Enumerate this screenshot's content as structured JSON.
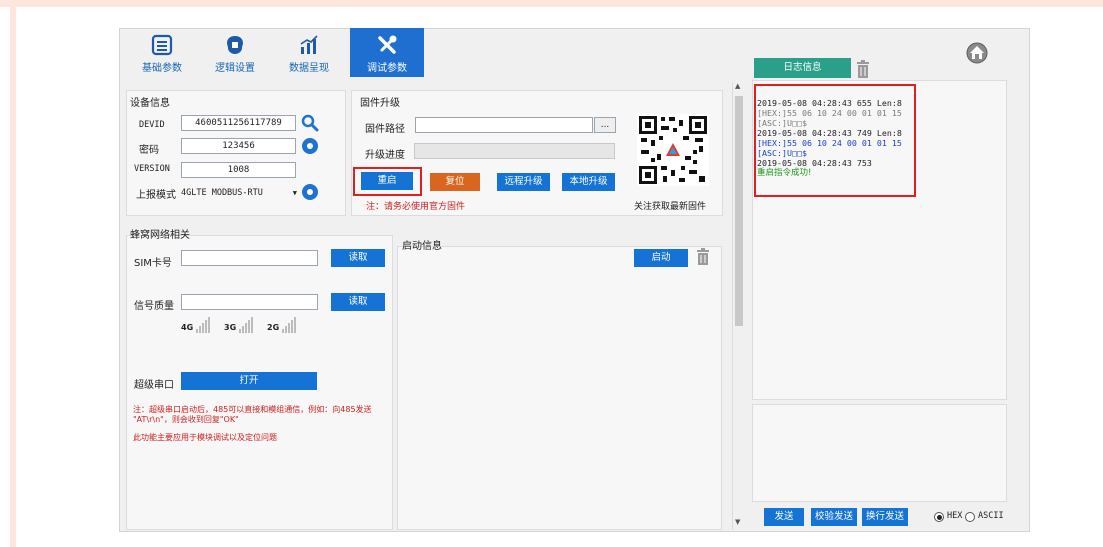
{
  "tabs": [
    {
      "label": "基础参数",
      "icon": "list-icon"
    },
    {
      "label": "逻辑设置",
      "icon": "brain-chip-icon"
    },
    {
      "label": "数据呈现",
      "icon": "chart-icon"
    },
    {
      "label": "调试参数",
      "icon": "wrench-icon",
      "active": true
    }
  ],
  "device": {
    "section_title": "设备信息",
    "devid_label": "DEVID",
    "devid_value": "4600511256117789",
    "password_label": "密码",
    "password_value": "123456",
    "version_label": "VERSION",
    "version_value": "1008",
    "report_mode_label": "上报模式",
    "report_mode_value": "4GLTE  MODBUS-RTU"
  },
  "firmware": {
    "section_title": "固件升级",
    "path_label": "固件路径",
    "browse_label": "...",
    "progress_label": "升级进度",
    "restart_label": "重启",
    "reset_label": "复位",
    "remote_upgrade_label": "远程升级",
    "local_upgrade_label": "本地升级",
    "note": "注：请务必使用官方固件",
    "qr_caption": "关注获取最新固件"
  },
  "cellular": {
    "section_title": "蜂窝网络相关",
    "sim_label": "SIM卡号",
    "sim_read_label": "读取",
    "signal_label": "信号质量",
    "signal_read_label": "读取",
    "signal_4g": "4G",
    "signal_3g": "3G",
    "signal_2g": "2G",
    "serial_label": "超级串口",
    "serial_open_label": "打开",
    "note1": "注：超级串口启动后，485可以直接和模组通信，例如：向485发送",
    "note2": "\"AT\\r\\n\"，则会收到回复\"OK\"",
    "note3": "此功能主要应用于模块调试以及定位问题"
  },
  "boot": {
    "section_title": "启动信息",
    "start_label": "启动"
  },
  "log": {
    "tab_label": "日志信息",
    "lines": [
      {
        "text": "2019-05-08 04:28:43 655 Len:8",
        "color": "#222222"
      },
      {
        "text": "[HEX:]55 06 10 24 00 01 01 15",
        "color": "#7a7a7a"
      },
      {
        "text": "[ASC:]U□□$",
        "color": "#7a7a7a"
      },
      {
        "text": "2019-05-08 04:28:43 749 Len:8",
        "color": "#222222"
      },
      {
        "text": "[HEX:]55 06 10 24 00 01 01 15",
        "color": "#1a3fd1"
      },
      {
        "text": "[ASC:]U□□$",
        "color": "#1a3fd1"
      },
      {
        "text": "2019-05-08 04:28:43 753",
        "color": "#222222"
      },
      {
        "text": "重启指令成功!",
        "color": "#1a9a1a"
      }
    ],
    "send_label": "发送",
    "checksum_send_label": "校验发送",
    "newline_send_label": "换行发送",
    "hex_label": "HEX",
    "ascii_label": "ASCII",
    "format_selected": "HEX"
  },
  "colors": {
    "accent_blue": "#1e6fd0",
    "button_blue": "#1473d4",
    "button_orange": "#d9661f",
    "log_tab_teal": "#2aa08a",
    "highlight_red": "#e02020"
  }
}
